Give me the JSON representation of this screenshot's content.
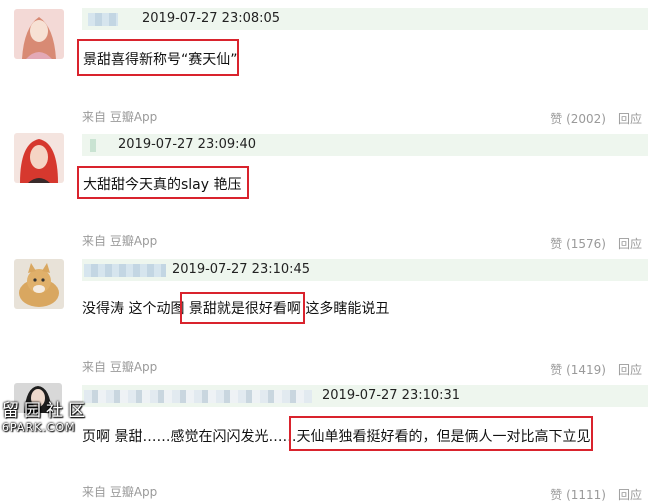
{
  "comments": [
    {
      "timestamp": "2019-07-27 23:08:05",
      "text": "景甜喜得新称号“赛天仙”",
      "source": "来自 豆瓣App",
      "likes": "赞 (2002)",
      "reply": "回应"
    },
    {
      "timestamp": "2019-07-27 23:09:40",
      "text": "大甜甜今天真的slay 艳压",
      "source": "来自 豆瓣App",
      "likes": "赞 (1576)",
      "reply": "回应"
    },
    {
      "timestamp": "2019-07-27 23:10:45",
      "text_before": "没得涛 这个动图 ",
      "text_highlight": "景甜就是很好看啊",
      "text_after": " 这多瞎能说丑",
      "source": "来自 豆瓣App",
      "likes": "赞 (1419)",
      "reply": "回应"
    },
    {
      "timestamp": "2019-07-27 23:10:31",
      "text_before": "页啊 景甜……感觉在闪闪发光……",
      "text_highlight": "天仙单独看挺好看的，但是俩人一对比高下立见",
      "source": "来自 豆瓣App",
      "likes": "赞 (1111)",
      "reply": "回应"
    }
  ],
  "watermark": {
    "line1": "留园社区",
    "line2": "6PARK.COM"
  },
  "colors": {
    "highlight_border": "#d9232d",
    "meta_bar": "#eef6ee",
    "muted_text": "#9a9a9a"
  }
}
